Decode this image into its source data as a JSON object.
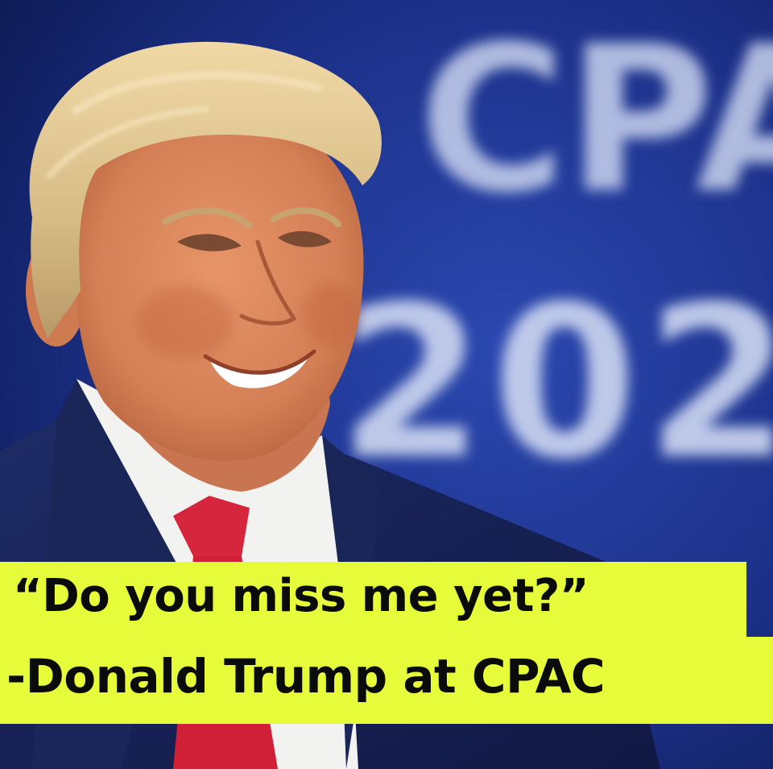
{
  "backdrop": {
    "sign_text": "202",
    "sign_top_text": "CPAC"
  },
  "caption": {
    "quote": "“Do you miss me yet?”",
    "attribution": "-Donald Trump at CPAC"
  },
  "colors": {
    "background_blue": "#1b2f86",
    "caption_highlight": "#e6fb3a",
    "caption_text": "#0b0b0b",
    "tie_red": "#d6263d",
    "suit_navy": "#16204a"
  }
}
